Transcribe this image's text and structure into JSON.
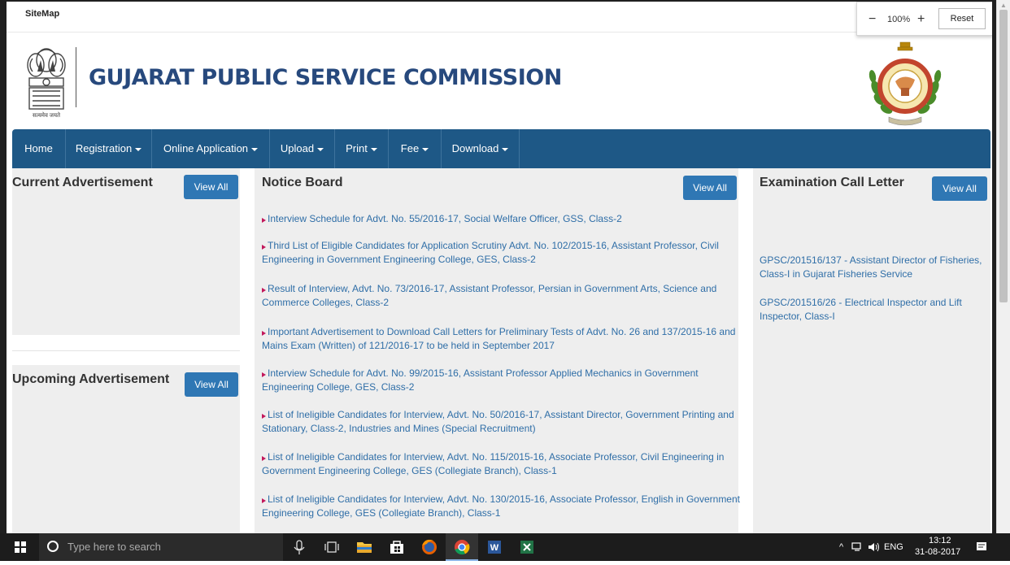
{
  "sitemap": {
    "label": "SiteMap"
  },
  "zoom": {
    "minus": "−",
    "value": "100%",
    "plus": "+",
    "reset": "Reset"
  },
  "header": {
    "title": "GUJARAT PUBLIC SERVICE COMMISSION",
    "emblem_motto": "सत्यमेव जयते"
  },
  "nav": {
    "items": [
      {
        "label": "Home",
        "dropdown": false
      },
      {
        "label": "Registration",
        "dropdown": true
      },
      {
        "label": "Online Application",
        "dropdown": true
      },
      {
        "label": "Upload",
        "dropdown": true
      },
      {
        "label": "Print",
        "dropdown": true
      },
      {
        "label": "Fee",
        "dropdown": true
      },
      {
        "label": "Download",
        "dropdown": true
      }
    ]
  },
  "current_ads": {
    "title": "Current Advertisement",
    "button": "View All"
  },
  "upcoming_ads": {
    "title": "Upcoming Advertisement",
    "button": "View All"
  },
  "notice_board": {
    "title": "Notice Board",
    "button": "View All",
    "items": [
      "Interview Schedule for Advt. No. 55/2016-17, Social Welfare Officer, GSS, Class-2",
      "Third List of Eligible Candidates for Application Scrutiny Advt. No. 102/2015-16, Assistant Professor, Civil Engineering in Government Engineering College, GES, Class-2",
      "Result of Interview, Advt. No. 73/2016-17, Assistant Professor, Persian in Government Arts, Science and Commerce Colleges, Class-2",
      "Important Advertisement to Download Call Letters for Preliminary Tests of Advt. No. 26 and 137/2015-16 and Mains Exam (Written) of 121/2016-17 to be held in September 2017",
      "Interview Schedule for Advt. No. 99/2015-16, Assistant Professor Applied Mechanics in Government Engineering College, GES, Class-2",
      "List of Ineligible Candidates for Interview, Advt. No. 50/2016-17, Assistant Director, Government Printing and Stationary, Class-2, Industries and Mines (Special Recruitment)",
      "List of Ineligible Candidates for Interview, Advt. No. 115/2015-16, Associate Professor, Civil Engineering in Government Engineering College, GES (Collegiate Branch), Class-1",
      "List of Ineligible Candidates for Interview, Advt. No. 130/2015-16, Associate Professor, English in Government Engineering College, GES (Collegiate Branch), Class-1"
    ]
  },
  "exam_call": {
    "title": "Examination Call Letter",
    "button": "View All",
    "items": [
      "GPSC/201516/137 - Assistant Director of Fisheries, Class-I in Gujarat Fisheries Service",
      "GPSC/201516/26 - Electrical Inspector and Lift Inspector, Class-I"
    ]
  },
  "taskbar": {
    "search_placeholder": "Type here to search",
    "lang": "ENG",
    "time": "13:12",
    "date": "31-08-2017",
    "pinned_icons": [
      "microphone-icon",
      "task-view-icon",
      "file-explorer-icon",
      "store-icon",
      "firefox-icon",
      "chrome-icon",
      "word-icon",
      "excel-icon"
    ]
  },
  "colors": {
    "nav_bg": "#1e5886",
    "title": "#27497d",
    "button": "#2f77b4",
    "link": "#2f6ea7",
    "panel_bg": "#eeeeee",
    "bullet": "#c2185b"
  }
}
